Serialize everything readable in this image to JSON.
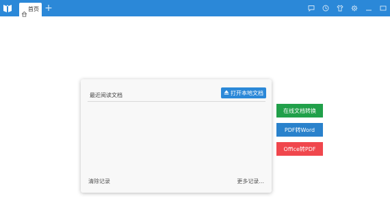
{
  "titlebar": {
    "background": "#2b88d8",
    "logo_icon": "book-icon",
    "tab": {
      "label": "首页",
      "icon": "home-icon"
    },
    "add_tab_label": "+",
    "window_icons": [
      "chat-icon",
      "clock-icon",
      "shirt-icon",
      "gear-icon",
      "minimize-icon",
      "maximize-icon"
    ]
  },
  "recent_panel": {
    "title": "最近阅读文档",
    "open_button_label": "打开本地文档",
    "open_button_icon": "eject-icon",
    "clear_label": "清除记录",
    "more_label": "更多记录..."
  },
  "side_buttons": {
    "online_convert": {
      "label": "在线文档转换",
      "color": "#21a04a"
    },
    "pdf_to_word": {
      "label": "PDF转Word",
      "color": "#2a82cc"
    },
    "office_to_pdf": {
      "label": "Office转PDF",
      "color": "#f0474d"
    }
  }
}
